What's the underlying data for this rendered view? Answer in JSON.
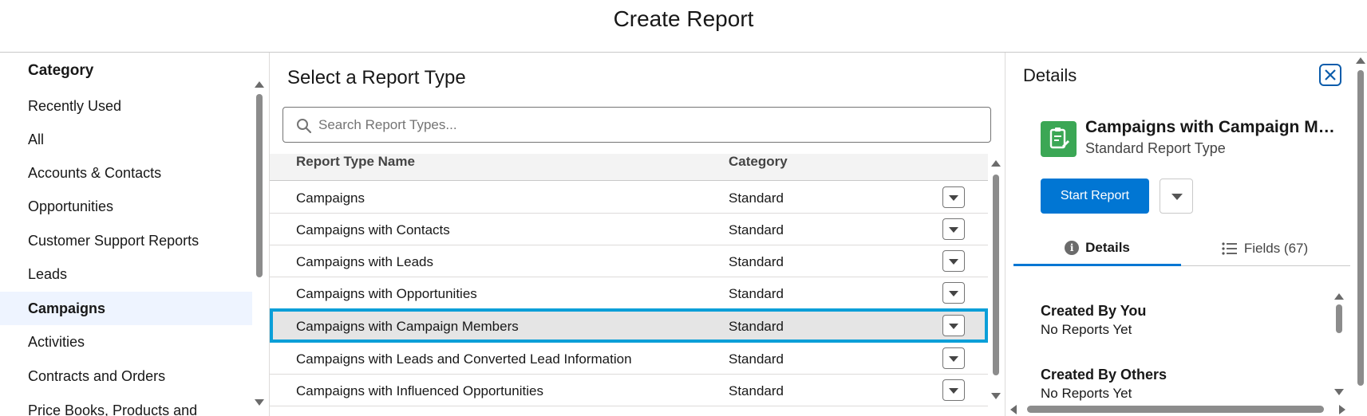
{
  "header": {
    "title": "Create Report"
  },
  "category_panel": {
    "heading": "Category",
    "items": [
      {
        "label": "Recently Used"
      },
      {
        "label": "All"
      },
      {
        "label": "Accounts & Contacts"
      },
      {
        "label": "Opportunities"
      },
      {
        "label": "Customer Support Reports"
      },
      {
        "label": "Leads"
      },
      {
        "label": "Campaigns",
        "selected": true
      },
      {
        "label": "Activities"
      },
      {
        "label": "Contracts and Orders"
      },
      {
        "label": "Price Books, Products and"
      }
    ]
  },
  "report_types": {
    "title": "Select a Report Type",
    "search_placeholder": "Search Report Types...",
    "columns": [
      "Report Type Name",
      "Category"
    ],
    "rows": [
      {
        "name": "Campaigns",
        "category": "Standard"
      },
      {
        "name": "Campaigns with Contacts",
        "category": "Standard"
      },
      {
        "name": "Campaigns with Leads",
        "category": "Standard"
      },
      {
        "name": "Campaigns with Opportunities",
        "category": "Standard"
      },
      {
        "name": "Campaigns with Campaign Members",
        "category": "Standard",
        "selected": true
      },
      {
        "name": "Campaigns with Leads and Converted Lead Information",
        "category": "Standard"
      },
      {
        "name": "Campaigns with Influenced Opportunities",
        "category": "Standard"
      }
    ]
  },
  "details": {
    "title": "Details",
    "report_name": "Campaigns with Campaign Members",
    "report_kind": "Standard Report Type",
    "start_button": "Start Report",
    "tabs": [
      {
        "label": "Details",
        "icon": "info-icon",
        "active": true
      },
      {
        "label": "Fields (67)",
        "icon": "list-icon",
        "active": false
      }
    ],
    "sections": [
      {
        "heading": "Created By You",
        "value": "No Reports Yet"
      },
      {
        "heading": "Created By Others",
        "value": "No Reports Yet"
      }
    ]
  },
  "colors": {
    "brand_blue": "#0176d3",
    "selection_outline": "#0b9fd8",
    "report_icon_green": "#3ba755",
    "selected_category_bg": "#eef4ff"
  }
}
